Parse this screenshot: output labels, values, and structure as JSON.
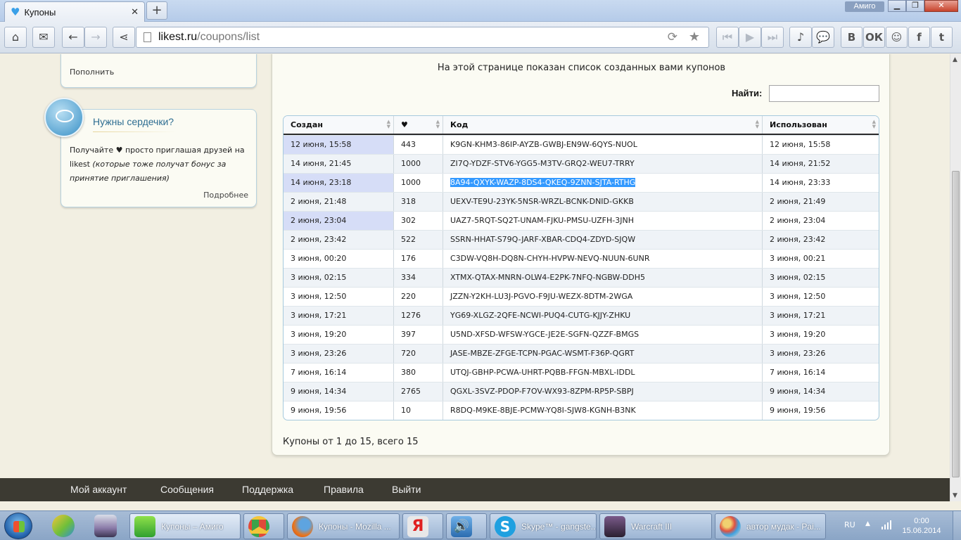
{
  "browser": {
    "tab_title": "Купоны",
    "new_tab_label": "+",
    "profile_label": "Амиго",
    "url_host": "likest.ru",
    "url_path": "/coupons/list"
  },
  "sidebar": {
    "topup_link": "Пополнить",
    "hearts_card": {
      "title": "Нужны сердечки?",
      "text_main": "Получайте ♥ просто приглашая друзей на likest",
      "text_note": "(которые тоже получат бонус за принятие приглашения)",
      "more_link": "Подробнее"
    }
  },
  "main": {
    "intro": "На этой странице показан список созданных вами купонов",
    "search_label": "Найти:",
    "search_value": "",
    "table": {
      "headers": [
        "Создан",
        "♥",
        "Код",
        "Использован"
      ],
      "rows": [
        {
          "created": "12 июня, 15:58",
          "hearts": "443",
          "code": "K9GN-KHM3-86IP-AYZB-GWBJ-EN9W-6QYS-NUOL",
          "used": "12 июня, 15:58"
        },
        {
          "created": "14 июня, 21:45",
          "hearts": "1000",
          "code": "ZI7Q-YDZF-STV6-YGG5-M3TV-GRQ2-WEU7-TRRY",
          "used": "14 июня, 21:52"
        },
        {
          "created": "14 июня, 23:18",
          "hearts": "1000",
          "code": "8A94-QXYK-WAZP-8DS4-QKEQ-9ZNN-SJTA-RTHG",
          "used": "14 июня, 23:33"
        },
        {
          "created": "2 июня, 21:48",
          "hearts": "318",
          "code": "UEXV-TE9U-23YK-5NSR-WRZL-BCNK-DNID-GKKB",
          "used": "2 июня, 21:49"
        },
        {
          "created": "2 июня, 23:04",
          "hearts": "302",
          "code": "UAZ7-5RQT-SQ2T-UNAM-FJKU-PMSU-UZFH-3JNH",
          "used": "2 июня, 23:04"
        },
        {
          "created": "2 июня, 23:42",
          "hearts": "522",
          "code": "SSRN-HHAT-S79Q-JARF-XBAR-CDQ4-ZDYD-SJQW",
          "used": "2 июня, 23:42"
        },
        {
          "created": "3 июня, 00:20",
          "hearts": "176",
          "code": "C3DW-VQ8H-DQ8N-CHYH-HVPW-NEVQ-NUUN-6UNR",
          "used": "3 июня, 00:21"
        },
        {
          "created": "3 июня, 02:15",
          "hearts": "334",
          "code": "XTMX-QTAX-MNRN-OLW4-E2PK-7NFQ-NGBW-DDH5",
          "used": "3 июня, 02:15"
        },
        {
          "created": "3 июня, 12:50",
          "hearts": "220",
          "code": "JZZN-Y2KH-LU3J-PGVO-F9JU-WEZX-8DTM-2WGA",
          "used": "3 июня, 12:50"
        },
        {
          "created": "3 июня, 17:21",
          "hearts": "1276",
          "code": "YG69-XLGZ-2QFE-NCWI-PUQ4-CUTG-KJJY-ZHKU",
          "used": "3 июня, 17:21"
        },
        {
          "created": "3 июня, 19:20",
          "hearts": "397",
          "code": "U5ND-XFSD-WFSW-YGCE-JE2E-SGFN-QZZF-BMGS",
          "used": "3 июня, 19:20"
        },
        {
          "created": "3 июня, 23:26",
          "hearts": "720",
          "code": "JASE-MBZE-ZFGE-TCPN-PGAC-WSMT-F36P-QGRT",
          "used": "3 июня, 23:26"
        },
        {
          "created": "7 июня, 16:14",
          "hearts": "380",
          "code": "UTQJ-GBHP-PCWA-UHRT-PQBB-FFGN-MBXL-IDDL",
          "used": "7 июня, 16:14"
        },
        {
          "created": "9 июня, 14:34",
          "hearts": "2765",
          "code": "QGXL-3SVZ-PDOP-F7OV-WX93-8ZPM-RP5P-SBPJ",
          "used": "9 июня, 14:34"
        },
        {
          "created": "9 июня, 19:56",
          "hearts": "10",
          "code": "R8DQ-M9KE-8BJE-PCMW-YQ8I-SJW8-KGNH-B3NK",
          "used": "9 июня, 19:56"
        }
      ]
    },
    "pager": "Купоны от 1 до 15, всего 15"
  },
  "footer": {
    "links": [
      "Мой аккаунт",
      "Сообщения",
      "Поддержка",
      "Правила",
      "Выйти"
    ]
  },
  "taskbar": {
    "tasks": [
      "Купоны – Амиго",
      "Купоны - Mozilla ...",
      "Skype™ - gangste...",
      "Warcraft III",
      "автор мудак - Pai..."
    ],
    "lang": "RU",
    "time": "0:00",
    "date": "15.06.2014"
  },
  "colors": {
    "page_bg": "#f2efe2",
    "card_border": "#b7d2de",
    "selection": "#3399ff",
    "footer_bg": "#3c3a32"
  }
}
